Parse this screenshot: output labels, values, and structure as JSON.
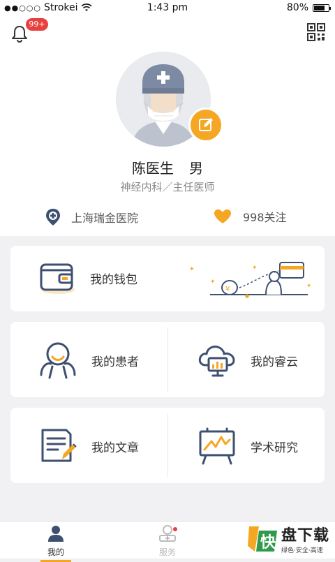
{
  "status_bar": {
    "carrier": "Strokei",
    "time": "1:43 pm",
    "battery": "80%",
    "battery_level": 0.8
  },
  "header": {
    "notification_badge": "99+"
  },
  "profile": {
    "name": "陈医生",
    "gender": "男",
    "department": "神经内科／主任医师",
    "hospital": "上海瑞金医院",
    "follow_count": "998关注"
  },
  "menu": {
    "wallet": "我的钱包",
    "patients": "我的患者",
    "ruiyun": "我的睿云",
    "articles": "我的文章",
    "research": "学术研究"
  },
  "tabs": [
    {
      "label": "我的",
      "active": true
    },
    {
      "label": "服务",
      "active": false
    }
  ],
  "watermark": {
    "title": "盘下载",
    "subtitle": "绿色·安全·高速"
  },
  "colors": {
    "accent": "#f5a623",
    "icon_blue": "#3e4f70",
    "badge_red": "#e8403f"
  }
}
